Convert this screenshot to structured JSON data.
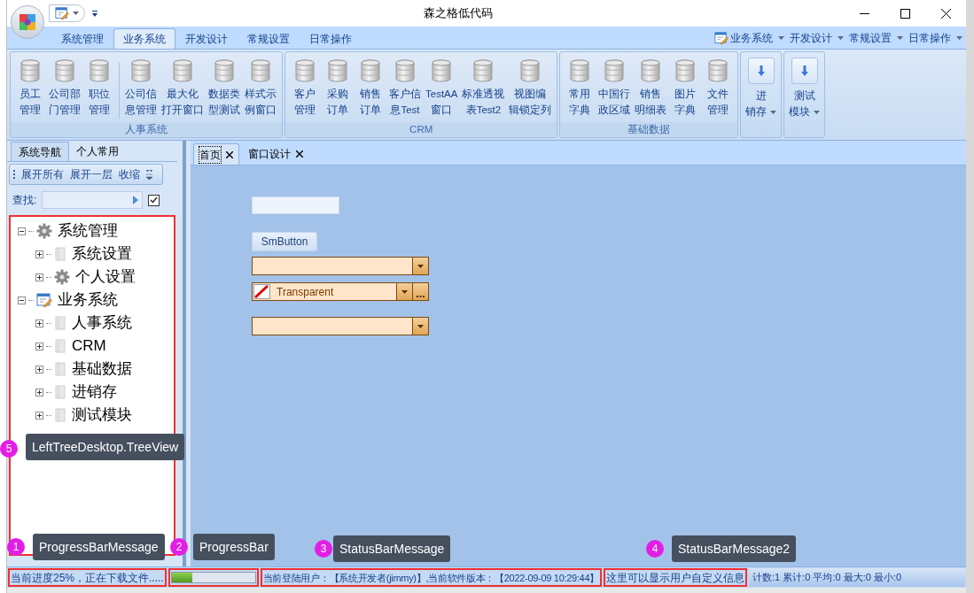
{
  "window": {
    "title": "森之格低代码"
  },
  "ribbon": {
    "tabs": [
      {
        "label": "系统管理",
        "selected": false
      },
      {
        "label": "业务系统",
        "selected": true
      },
      {
        "label": "开发设计",
        "selected": false
      },
      {
        "label": "常规设置",
        "selected": false
      },
      {
        "label": "日常操作",
        "selected": false
      }
    ],
    "menus": [
      {
        "label": "业务系统",
        "kind": "icon"
      },
      {
        "label": "开发设计",
        "kind": "plain"
      },
      {
        "label": "常规设置",
        "kind": "plain"
      },
      {
        "label": "日常操作",
        "kind": "plain"
      }
    ],
    "groups": [
      {
        "kind": "large",
        "title": "人事系统",
        "items": [
          {
            "kind": "button",
            "lines": [
              "员工",
              "管理"
            ]
          },
          {
            "kind": "button",
            "lines": [
              "公司部",
              "门管理"
            ]
          },
          {
            "kind": "button",
            "lines": [
              "职位",
              "管理"
            ]
          },
          {
            "kind": "divider"
          },
          {
            "kind": "button",
            "lines": [
              "公司信",
              "息管理"
            ]
          },
          {
            "kind": "button",
            "lines": [
              "最大化",
              "打开窗口"
            ]
          },
          {
            "kind": "button",
            "lines": [
              "数据类",
              "型测试"
            ]
          },
          {
            "kind": "button",
            "lines": [
              "样式示",
              "例窗口"
            ]
          }
        ]
      },
      {
        "kind": "large",
        "title": "CRM",
        "items": [
          {
            "kind": "button",
            "lines": [
              "客户",
              "管理"
            ]
          },
          {
            "kind": "button",
            "lines": [
              "采购",
              "订单"
            ]
          },
          {
            "kind": "button",
            "lines": [
              "销售",
              "订单"
            ]
          },
          {
            "kind": "button",
            "lines": [
              "客户信",
              "息Test"
            ]
          },
          {
            "kind": "button",
            "lines": [
              "TestAA",
              "窗口"
            ]
          },
          {
            "kind": "button",
            "lines": [
              "标准透视",
              "表Test2"
            ]
          },
          {
            "kind": "button",
            "lines": [
              "视图编",
              "辑锁定列"
            ]
          }
        ]
      },
      {
        "kind": "large",
        "title": "基础数据",
        "items": [
          {
            "kind": "button",
            "lines": [
              "常用",
              "字典"
            ]
          },
          {
            "kind": "button",
            "lines": [
              "中国行",
              "政区域"
            ]
          },
          {
            "kind": "button",
            "lines": [
              "销售",
              "明细表"
            ]
          },
          {
            "kind": "button",
            "lines": [
              "图片",
              "字典"
            ]
          },
          {
            "kind": "button",
            "lines": [
              "文件",
              "管理"
            ]
          }
        ]
      },
      {
        "kind": "dropdown",
        "items": [
          {
            "kind": "button",
            "lines": [
              "进",
              "销存"
            ]
          }
        ]
      },
      {
        "kind": "dropdown",
        "items": [
          {
            "kind": "button",
            "lines": [
              "测试",
              "模块"
            ]
          }
        ]
      }
    ]
  },
  "navigator": {
    "tabs": [
      {
        "label": "系统导航",
        "selected": true
      },
      {
        "label": "个人常用",
        "selected": false
      }
    ],
    "toolbar": [
      "展开所有",
      "展开一层",
      "收缩"
    ],
    "search": {
      "label": "查找:",
      "checked": true
    },
    "tree": [
      {
        "label": "系统管理",
        "kind": "gear",
        "expanded": true,
        "children": [
          {
            "label": "系统设置",
            "kind": "page",
            "expanded": false
          },
          {
            "label": "个人设置",
            "kind": "gear",
            "expanded": false
          }
        ]
      },
      {
        "label": "业务系统",
        "kind": "edit",
        "expanded": true,
        "children": [
          {
            "label": "人事系统",
            "kind": "page",
            "expanded": false
          },
          {
            "label": "CRM",
            "kind": "page",
            "expanded": false
          },
          {
            "label": "基础数据",
            "kind": "page",
            "expanded": false
          },
          {
            "label": "进销存",
            "kind": "page",
            "expanded": false
          },
          {
            "label": "测试模块",
            "kind": "page",
            "expanded": false
          }
        ]
      }
    ]
  },
  "documents": {
    "tabs": [
      {
        "label": "首页",
        "selected": true
      },
      {
        "label": "窗口设计",
        "selected": false
      }
    ],
    "controls": [
      {
        "kind": "textbox"
      },
      {
        "kind": "button",
        "label": "SmButton"
      },
      {
        "kind": "combo"
      },
      {
        "kind": "color-combo",
        "value": "Transparent"
      },
      {
        "kind": "combo"
      }
    ]
  },
  "status_bar": {
    "progress_message": "当前进度25%，正在下载文件.....",
    "progress": {
      "level": 0.25
    },
    "message": "当前登陆用户：【系统开发者(jimmy)】,当前软件版本：【2022-09-09 10:29:44】",
    "message2": "这里可以显示用户自定义信息",
    "summary": "计数:1 累计:0 平均:0 最大:0 最小:0"
  },
  "annotations": [
    {
      "number": "1",
      "label": "ProgressBarMessage"
    },
    {
      "number": "2",
      "label": "ProgressBar"
    },
    {
      "number": "3",
      "label": "StatusBarMessage"
    },
    {
      "number": "4",
      "label": "StatusBarMessage2"
    },
    {
      "number": "5",
      "label": "LeftTreeDesktop.TreeView"
    }
  ]
}
